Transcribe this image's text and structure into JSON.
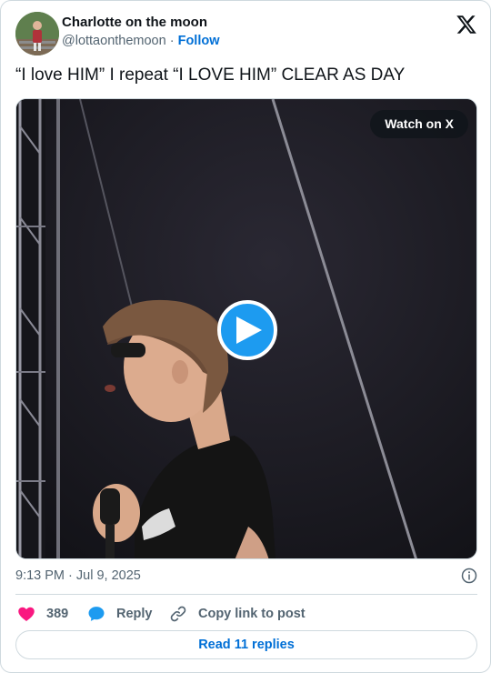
{
  "author": {
    "name": "Charlotte on the moon",
    "handle": "@lottaonthemoon",
    "separator": "·",
    "follow_label": "Follow"
  },
  "tweet": {
    "text": "“I love HIM” I repeat “I LOVE HIM” CLEAR AS DAY",
    "time": "9:13 PM · Jul 9, 2025"
  },
  "media": {
    "watch_label": "Watch on X",
    "type": "video"
  },
  "actions": {
    "like_count": "389",
    "reply_label": "Reply",
    "copy_label": "Copy link to post"
  },
  "footer": {
    "read_replies_label": "Read 11 replies"
  },
  "colors": {
    "like": "#f91880",
    "accent": "#1d9bf0",
    "link": "#006fd6",
    "muted": "#536471"
  },
  "icons": {
    "logo": "x-logo-icon",
    "play": "play-icon",
    "info": "info-icon",
    "like": "heart-icon",
    "reply": "speech-bubble-icon",
    "copy": "link-icon"
  }
}
